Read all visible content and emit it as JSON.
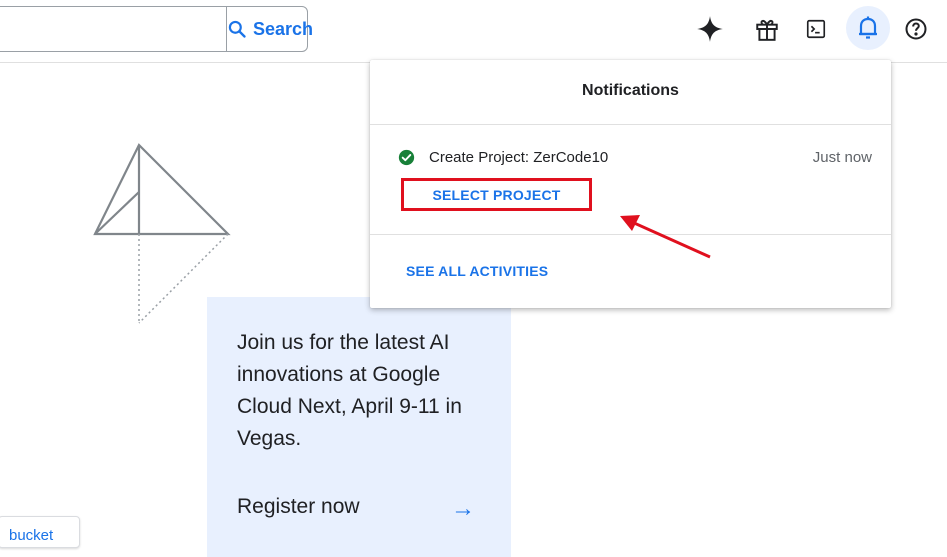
{
  "search": {
    "value": "",
    "placeholder": "",
    "button_label": "Search"
  },
  "toolbar": {
    "icons": [
      "gemini-sparkle-icon",
      "gift-icon",
      "cloud-shell-terminal-icon",
      "notifications-bell-icon",
      "help-icon"
    ]
  },
  "promo": {
    "text": "Join us for the latest AI innovations at Google Cloud Next, April 9-11 in Vegas.",
    "cta_label": "Register now",
    "arrow": "→"
  },
  "bucket_chip": {
    "label": "bucket"
  },
  "notifications": {
    "title": "Notifications",
    "items": [
      {
        "title": "Create Project: ZerCode10",
        "time": "Just now",
        "status": "success",
        "action_label": "SELECT PROJECT"
      }
    ],
    "see_all_label": "SEE ALL ACTIVITIES"
  },
  "colors": {
    "accent": "#1a73e8",
    "success": "#188038",
    "annotation": "#e0101e",
    "promo_bg": "#e8f0fe"
  }
}
